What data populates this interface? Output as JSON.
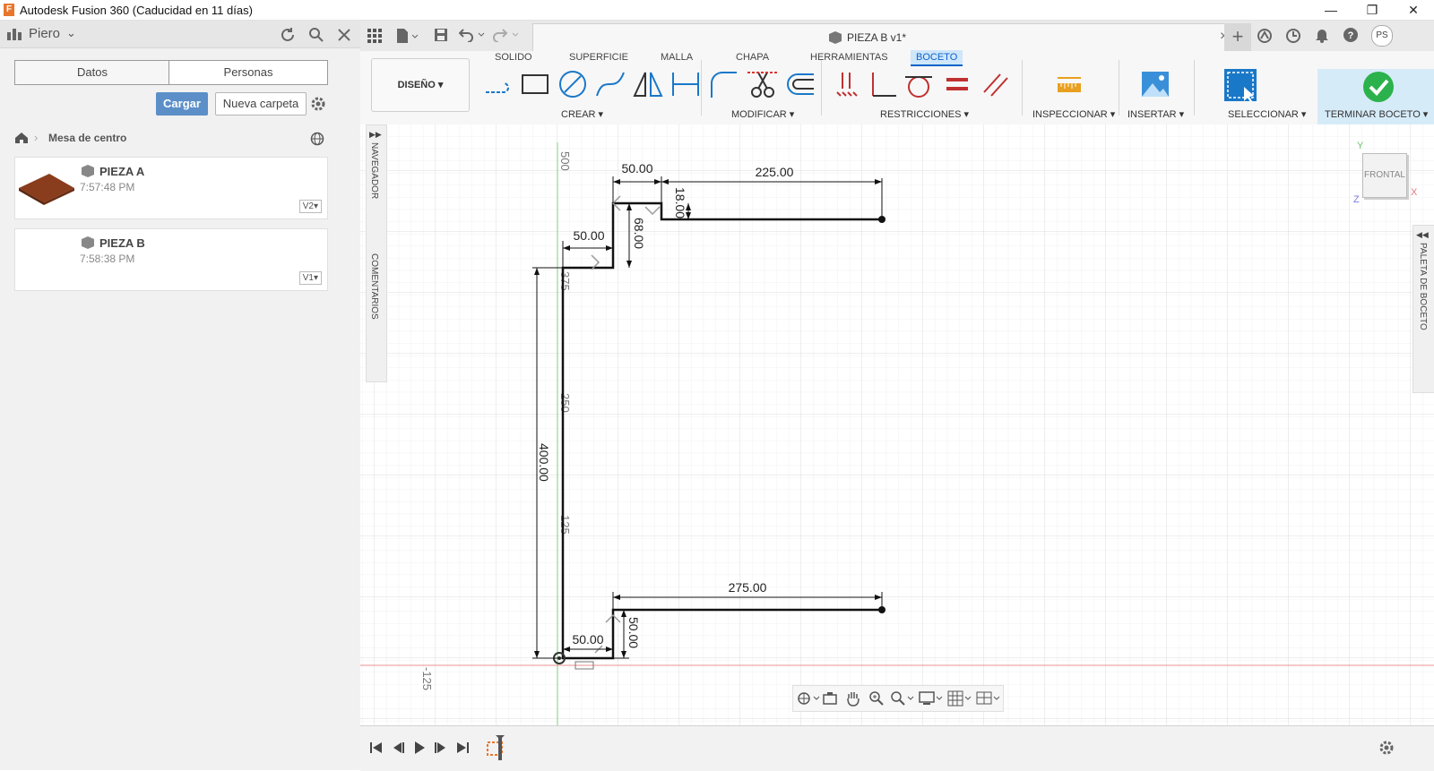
{
  "window": {
    "title": "Autodesk Fusion 360 (Caducidad en 11 días)",
    "minimize": "—",
    "maximize": "❐",
    "close": "✕"
  },
  "left_panel": {
    "user": "Piero",
    "tabs": [
      "Datos",
      "Personas"
    ],
    "upload_label": "Cargar",
    "new_folder_label": "Nueva carpeta",
    "breadcrumb": "Mesa de centro",
    "files": [
      {
        "name": "PIEZA A",
        "time": "7:57:48 PM",
        "version": "V2▾"
      },
      {
        "name": "PIEZA B",
        "time": "7:58:38 PM",
        "version": "V1▾"
      }
    ]
  },
  "document": {
    "tab_title": "PIEZA B v1*",
    "close": "×",
    "user_initials": "PS"
  },
  "ribbon": {
    "workspace": "DISEÑO ▾",
    "tabs": [
      "SOLIDO",
      "SUPERFICIE",
      "MALLA",
      "CHAPA",
      "HERRAMIENTAS",
      "BOCETO"
    ],
    "active_tab": "BOCETO",
    "groups": {
      "create": "CREAR ▾",
      "modify": "MODIFICAR ▾",
      "constraints": "RESTRICCIONES ▾",
      "inspect": "INSPECCIONAR ▾",
      "insert": "INSERTAR ▾",
      "select": "SELECCIONAR ▾",
      "finish": "TERMINAR BOCETO ▾"
    }
  },
  "side_panels": {
    "navigator": "NAVEGADOR",
    "comments": "COMENTARIOS",
    "palette": "PALETA DE BOCETO"
  },
  "viewcube": {
    "face": "FRONTAL",
    "x": "X",
    "y": "Y",
    "z": "Z"
  },
  "sketch": {
    "ruler": {
      "v500": "500",
      "v375": "375",
      "v250": "250",
      "v125": "125",
      "vneg125": "-125"
    },
    "dimensions": {
      "top_step_width": "50.00",
      "top_arm_length": "225.00",
      "top_arm_thickness": "18.00",
      "top_step_height": "68.00",
      "mid_step_width": "50.00",
      "total_height": "400.00",
      "bottom_arm_length": "275.00",
      "bottom_step_height": "50.00",
      "bottom_step_width": "50.00"
    }
  },
  "colors": {
    "accent": "#0a64c8",
    "primary_button": "#5c8fc8",
    "finish_green": "#2bb24c",
    "axis_red": "#e07a7a",
    "axis_green": "#6fc46f"
  }
}
